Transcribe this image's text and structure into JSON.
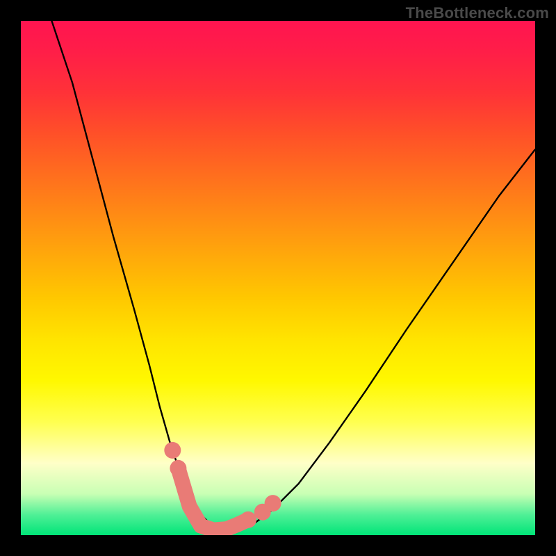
{
  "attribution": "TheBottleneck.com",
  "chart_data": {
    "type": "line",
    "title": "",
    "xlabel": "",
    "ylabel": "",
    "xlim": [
      0,
      100
    ],
    "ylim": [
      0,
      100
    ],
    "series": [
      {
        "name": "bottleneck-curve",
        "x": [
          6,
          10,
          14,
          18,
          22,
          25,
          27,
          29,
          31,
          33,
          35,
          37,
          39,
          42,
          45,
          49,
          54,
          60,
          67,
          75,
          84,
          93,
          100
        ],
        "values": [
          100,
          88,
          73,
          58,
          44,
          33,
          25,
          18,
          12,
          7,
          4,
          2,
          1,
          1,
          2,
          5,
          10,
          18,
          28,
          40,
          53,
          66,
          75
        ]
      }
    ],
    "markers": [
      {
        "name": "left-upper-dot",
        "x": 29.5,
        "y": 16.5
      },
      {
        "name": "left-lower-dot",
        "x": 30.6,
        "y": 13.0
      },
      {
        "name": "right-lower-dot",
        "x": 44.2,
        "y": 3.0
      },
      {
        "name": "right-mid-dot",
        "x": 47.0,
        "y": 4.5
      },
      {
        "name": "right-upper-dot",
        "x": 49.0,
        "y": 6.2
      }
    ],
    "valley_band": {
      "name": "valley-band",
      "x": [
        30.6,
        32.8,
        35.0,
        37.5,
        40.0,
        42.0,
        44.2
      ],
      "y": [
        13.0,
        5.6,
        1.8,
        1.0,
        1.2,
        2.0,
        3.0
      ]
    },
    "colors": {
      "curve_stroke": "#000000",
      "marker_fill": "#e97b76",
      "band_stroke": "#e97b76"
    },
    "gradient_stops": [
      {
        "pos": 0,
        "color": "#ff1450"
      },
      {
        "pos": 50,
        "color": "#ffc800"
      },
      {
        "pos": 80,
        "color": "#ffff80"
      },
      {
        "pos": 100,
        "color": "#00e478"
      }
    ]
  }
}
